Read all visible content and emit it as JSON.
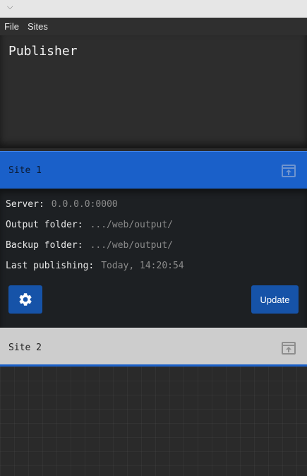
{
  "window": {
    "titlebar_icon": "chevron-down-icon"
  },
  "menu": [
    {
      "label": "File"
    },
    {
      "label": "Sites"
    }
  ],
  "app": {
    "title": "Publisher"
  },
  "sites": [
    {
      "name": "Site 1",
      "expanded": true,
      "header_color": "#1a60c9",
      "icon": "upload-box-icon",
      "details": [
        {
          "label": "Server:",
          "value": "0.0.0.0:0000"
        },
        {
          "label": "Output folder:",
          "value": ".../web/output/"
        },
        {
          "label": "Backup folder:",
          "value": ".../web/output/"
        },
        {
          "label": "Last publishing:",
          "value": "Today, 14:20:54"
        }
      ],
      "settings_icon": "gear-icon",
      "update_label": "Update"
    },
    {
      "name": "Site 2",
      "expanded": false,
      "header_color": "#cdcdcd",
      "icon": "upload-box-icon"
    }
  ],
  "colors": {
    "accent": "#1a60c9",
    "button": "#1653a8",
    "background": "#2b2b2b"
  }
}
